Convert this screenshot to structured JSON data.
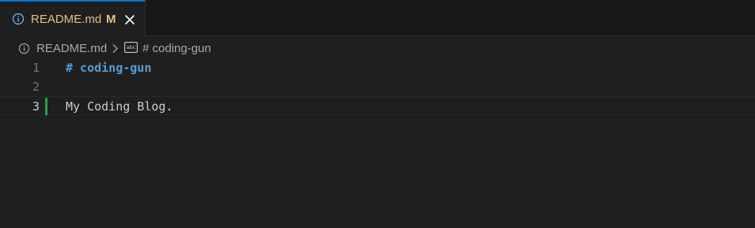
{
  "tab": {
    "title": "README.md",
    "badge": "M",
    "icon": "info-icon"
  },
  "breadcrumb": {
    "file": "README.md",
    "symbol": "# coding-gun",
    "file_icon": "info-icon",
    "symbol_icon": "string-symbol-icon"
  },
  "editor": {
    "lines": [
      {
        "number": "1",
        "text": "# coding-gun"
      },
      {
        "number": "2",
        "text": ""
      },
      {
        "number": "3",
        "text": "My Coding Blog."
      }
    ],
    "active_line": 3
  },
  "colors": {
    "accent": "#0078d4",
    "modified": "#e2c08d",
    "heading": "#569cd6",
    "added_gutter": "#2ea043",
    "background": "#1f1f1f"
  }
}
